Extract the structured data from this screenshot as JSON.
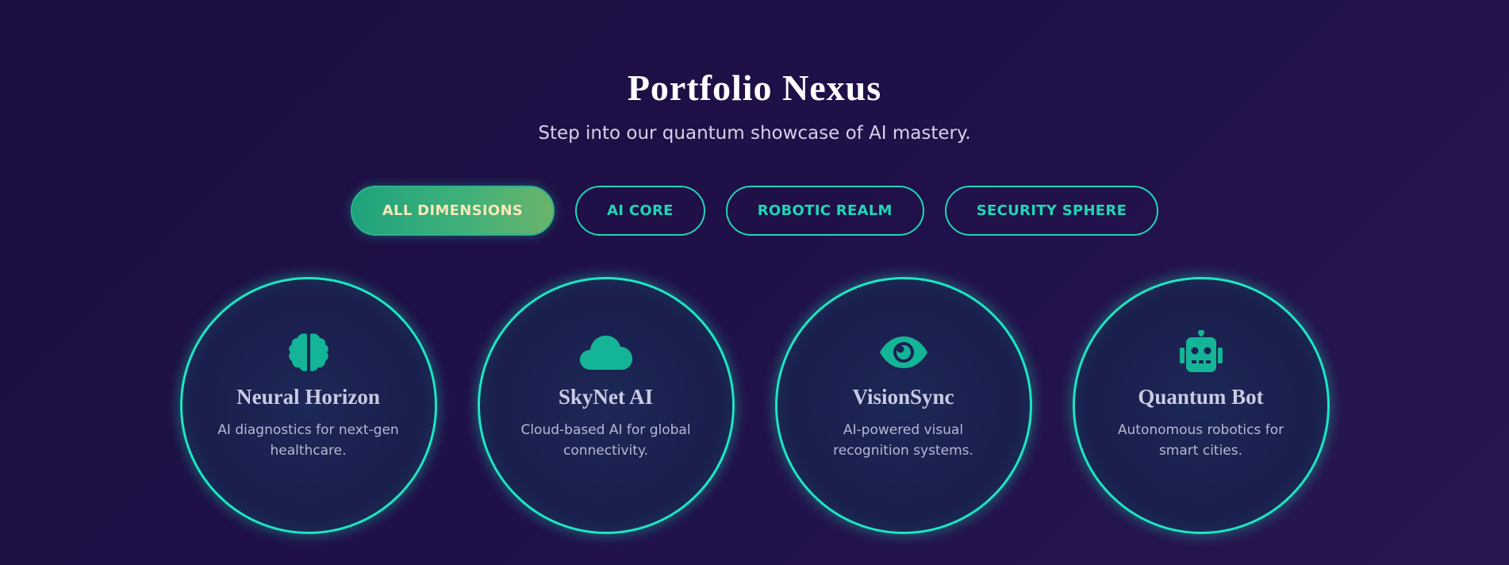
{
  "header": {
    "title": "Portfolio Nexus",
    "subtitle": "Step into our quantum showcase of AI mastery."
  },
  "filters": [
    {
      "label": "ALL DIMENSIONS",
      "active": true
    },
    {
      "label": "AI CORE",
      "active": false
    },
    {
      "label": "ROBOTIC REALM",
      "active": false
    },
    {
      "label": "SECURITY SPHERE",
      "active": false
    }
  ],
  "cards": [
    {
      "icon": "brain-icon",
      "title": "Neural Horizon",
      "description": "AI diagnostics for next-gen healthcare."
    },
    {
      "icon": "cloud-icon",
      "title": "SkyNet AI",
      "description": "Cloud-based AI for global connectivity."
    },
    {
      "icon": "eye-icon",
      "title": "VisionSync",
      "description": "AI-powered visual recognition systems."
    },
    {
      "icon": "robot-icon",
      "title": "Quantum Bot",
      "description": "Autonomous robotics for smart cities."
    }
  ],
  "colors": {
    "accent": "#1fd6b5",
    "icon": "#14b496",
    "background": "#1f1048"
  }
}
